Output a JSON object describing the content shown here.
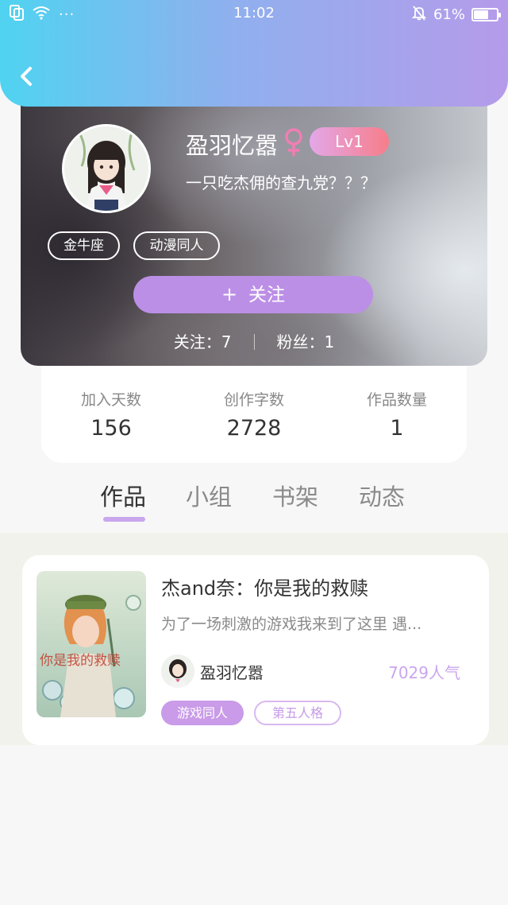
{
  "status_bar": {
    "time": "11:02",
    "dots": "···",
    "battery_text": "61%",
    "battery_level": 0.61,
    "icons": [
      "copy-icon",
      "wifi-icon",
      "bell-off-icon",
      "battery-icon"
    ]
  },
  "header": {
    "back_icon": "chevron-left-icon",
    "gradient": [
      "#4fd3f0",
      "#b59bea"
    ]
  },
  "profile": {
    "nickname": "盈羽忆嚣",
    "gender_symbol": "♀",
    "level": "Lv1",
    "bio": "一只吃杰佣的查九党？？？",
    "tags": [
      "金牛座",
      "动漫同人"
    ],
    "follow_plus": "+",
    "follow_label": "关注",
    "following_label": "关注：7",
    "followers_label": "粉丝：1"
  },
  "stats": [
    {
      "label": "加入天数",
      "value": "156"
    },
    {
      "label": "创作字数",
      "value": "2728"
    },
    {
      "label": "作品数量",
      "value": "1"
    }
  ],
  "tabs": [
    {
      "label": "作品",
      "active": true
    },
    {
      "label": "小组",
      "active": false
    },
    {
      "label": "书架",
      "active": false
    },
    {
      "label": "动态",
      "active": false
    }
  ],
  "works": [
    {
      "title": "杰and奈：你是我的救赎",
      "description": "为了一场刺激的游戏我来到了这里 遇...",
      "author": "盈羽忆嚣",
      "popularity": "7029人气",
      "tags": [
        "游戏同人",
        "第五人格"
      ]
    }
  ],
  "colors": {
    "accent": "#bc8fe6",
    "tab_indicator": "#c9a6ee",
    "level_badge": [
      "#e3a8e8",
      "#f77d8a"
    ],
    "popularity": "#c9a6ee"
  }
}
